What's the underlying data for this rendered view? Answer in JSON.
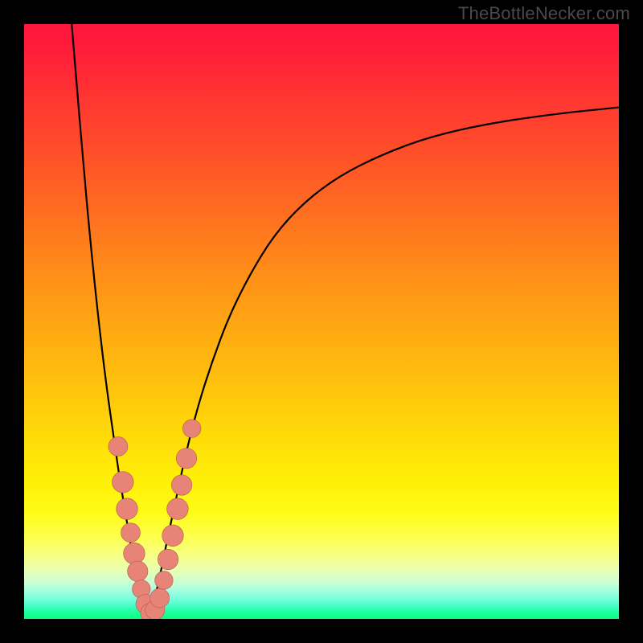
{
  "watermark": "TheBottleNecker.com",
  "colors": {
    "frame": "#000000",
    "curve": "#000000",
    "marker_fill": "#e78377",
    "marker_stroke": "#b35a4f"
  },
  "chart_data": {
    "type": "line",
    "title": "",
    "xlabel": "",
    "ylabel": "",
    "xlim": [
      0,
      100
    ],
    "ylim": [
      0,
      100
    ],
    "grid": false,
    "note": "Bottleneck-style curve: two branches descend from top edge, meet near x≈21 at y≈0, right branch rises again toward top-right. Salmon markers cluster near the minimum on both branches.",
    "series": [
      {
        "name": "left-branch",
        "x": [
          8.0,
          9.0,
          10.0,
          11.0,
          12.0,
          13.0,
          14.0,
          15.0,
          16.0,
          17.0,
          18.0,
          19.0,
          20.0,
          21.0
        ],
        "y": [
          100,
          88,
          76,
          65,
          55,
          46,
          38,
          31,
          24,
          18,
          12,
          7,
          3,
          0.5
        ]
      },
      {
        "name": "right-branch",
        "x": [
          21.0,
          22.0,
          23.0,
          24.0,
          25.5,
          27.0,
          29.0,
          31.5,
          34.5,
          38.0,
          42.0,
          47.0,
          53.0,
          60.0,
          68.0,
          78.0,
          90.0,
          100.0
        ],
        "y": [
          0.5,
          3.5,
          8.0,
          13.0,
          20.0,
          27.0,
          35.0,
          43.0,
          51.0,
          58.0,
          64.5,
          70.0,
          74.5,
          78.0,
          81.0,
          83.3,
          85.0,
          86.0
        ]
      }
    ],
    "markers": [
      {
        "x": 15.8,
        "y": 29.0,
        "r": 1.2
      },
      {
        "x": 16.6,
        "y": 23.0,
        "r": 1.4
      },
      {
        "x": 17.3,
        "y": 18.5,
        "r": 1.4
      },
      {
        "x": 17.9,
        "y": 14.5,
        "r": 1.2
      },
      {
        "x": 18.5,
        "y": 11.0,
        "r": 1.4
      },
      {
        "x": 19.1,
        "y": 8.0,
        "r": 1.3
      },
      {
        "x": 19.7,
        "y": 5.0,
        "r": 1.1
      },
      {
        "x": 20.4,
        "y": 2.5,
        "r": 1.2
      },
      {
        "x": 21.2,
        "y": 1.0,
        "r": 1.2
      },
      {
        "x": 22.0,
        "y": 1.5,
        "r": 1.2
      },
      {
        "x": 22.8,
        "y": 3.5,
        "r": 1.2
      },
      {
        "x": 23.5,
        "y": 6.5,
        "r": 1.1
      },
      {
        "x": 24.2,
        "y": 10.0,
        "r": 1.3
      },
      {
        "x": 25.0,
        "y": 14.0,
        "r": 1.4
      },
      {
        "x": 25.8,
        "y": 18.5,
        "r": 1.4
      },
      {
        "x": 26.5,
        "y": 22.5,
        "r": 1.3
      },
      {
        "x": 27.3,
        "y": 27.0,
        "r": 1.3
      },
      {
        "x": 28.2,
        "y": 32.0,
        "r": 1.1
      }
    ]
  }
}
